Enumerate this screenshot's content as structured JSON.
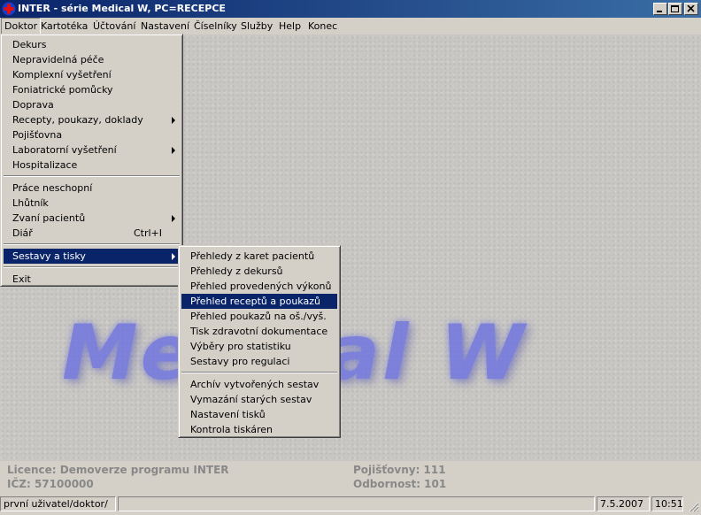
{
  "window": {
    "title": "INTER - série Medical W,  PC=RECEPCE",
    "app_icon": "medical-cross-icon"
  },
  "menubar": [
    "Doktor",
    "Kartotéka",
    "Účtování",
    "Nastavení",
    "Číselníky",
    "Služby",
    "Help",
    "Konec"
  ],
  "doktor_menu": [
    {
      "label": "Dekurs"
    },
    {
      "label": "Nepravidelná péče"
    },
    {
      "label": "Komplexní vyšetření"
    },
    {
      "label": "Foniatrické pomůcky"
    },
    {
      "label": "Doprava"
    },
    {
      "label": "Recepty, poukazy, doklady",
      "submenu": true
    },
    {
      "label": "Pojišťovna"
    },
    {
      "label": "Laboratorní vyšetření",
      "submenu": true
    },
    {
      "label": "Hospitalizace"
    },
    {
      "label": "Práce neschopní"
    },
    {
      "label": "Lhůtník"
    },
    {
      "label": "Zvaní pacientů",
      "submenu": true
    },
    {
      "label": "Diář",
      "shortcut": "Ctrl+I"
    },
    {
      "label": "Sestavy a tisky",
      "submenu": true,
      "highlighted": true
    },
    {
      "label": "Exit"
    }
  ],
  "sestavy_menu": [
    {
      "label": "Přehledy z karet pacientů"
    },
    {
      "label": "Přehledy z dekursů"
    },
    {
      "label": "Přehled provedených výkonů"
    },
    {
      "label": "Přehled receptů a poukazů",
      "highlighted": true
    },
    {
      "label": "Přehled poukazů na oš./vyš."
    },
    {
      "label": "Tisk zdravotní dokumentace"
    },
    {
      "label": "Výběry pro statistiku"
    },
    {
      "label": "Sestavy pro regulaci"
    },
    {
      "label": "Archív vytvořených sestav"
    },
    {
      "label": "Vymazání starých sestav"
    },
    {
      "label": "Nastavení tisků"
    },
    {
      "label": "Kontrola tiskáren"
    }
  ],
  "watermark": "Medical W",
  "info": {
    "licence": "Licence: Demoverze programu INTER",
    "icz": "IČZ: 57100000",
    "pojistovny": "Pojišťovny: 111",
    "odbornost": "Odbornost: 101"
  },
  "status": {
    "user": "první uživatel/doktor/",
    "date": "7.5.2007",
    "time": "10:51"
  },
  "colors": {
    "titlebar_start": "#0a246a",
    "titlebar_end": "#3a6ea5",
    "highlight": "#0a246a",
    "watermark": "#6b70e0"
  }
}
